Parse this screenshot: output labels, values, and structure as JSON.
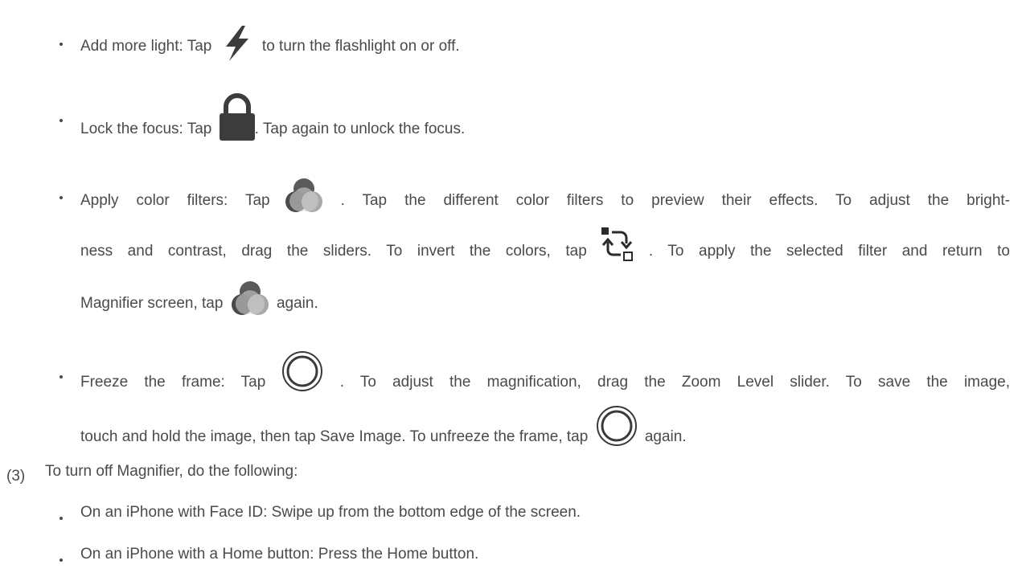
{
  "doc": {
    "bullets": {
      "flash": {
        "before": "Add more light: Tap",
        "after": "to turn the flashlight on or off.",
        "icon": "lightning-bolt-icon"
      },
      "lock": {
        "before": "Lock the focus: Tap",
        "after": ". Tap again to unlock the focus.",
        "icon": "lock-icon"
      },
      "filters": {
        "l1_before": "Apply color filters: Tap",
        "l1_after": ". Tap the different color filters to preview their effects. To adjust the bright-",
        "l2_before": "ness and contrast, drag the sliders. To invert the colors, tap",
        "l2_after": ". To apply the selected filter and return to",
        "l3_before": "Magnifier screen, tap",
        "l3_after": "again.",
        "icons": [
          "color-filters-icon",
          "invert-colors-icon"
        ]
      },
      "freeze": {
        "l1_before": "Freeze the frame: Tap",
        "l1_after": ". To adjust the magnification, drag the Zoom Level slider. To save the image,",
        "l2_before": "touch and hold the image, then tap Save Image. To unfreeze the frame, tap",
        "l2_after": "again.",
        "icon": "shutter-circle-icon"
      }
    },
    "step3": {
      "number": "(3)",
      "text": "To turn off Magnifier, do the following:",
      "items": [
        "On an iPhone with Face ID: Swipe up from the bottom edge of the screen.",
        "On an iPhone with a Home button: Press the Home button."
      ]
    }
  }
}
